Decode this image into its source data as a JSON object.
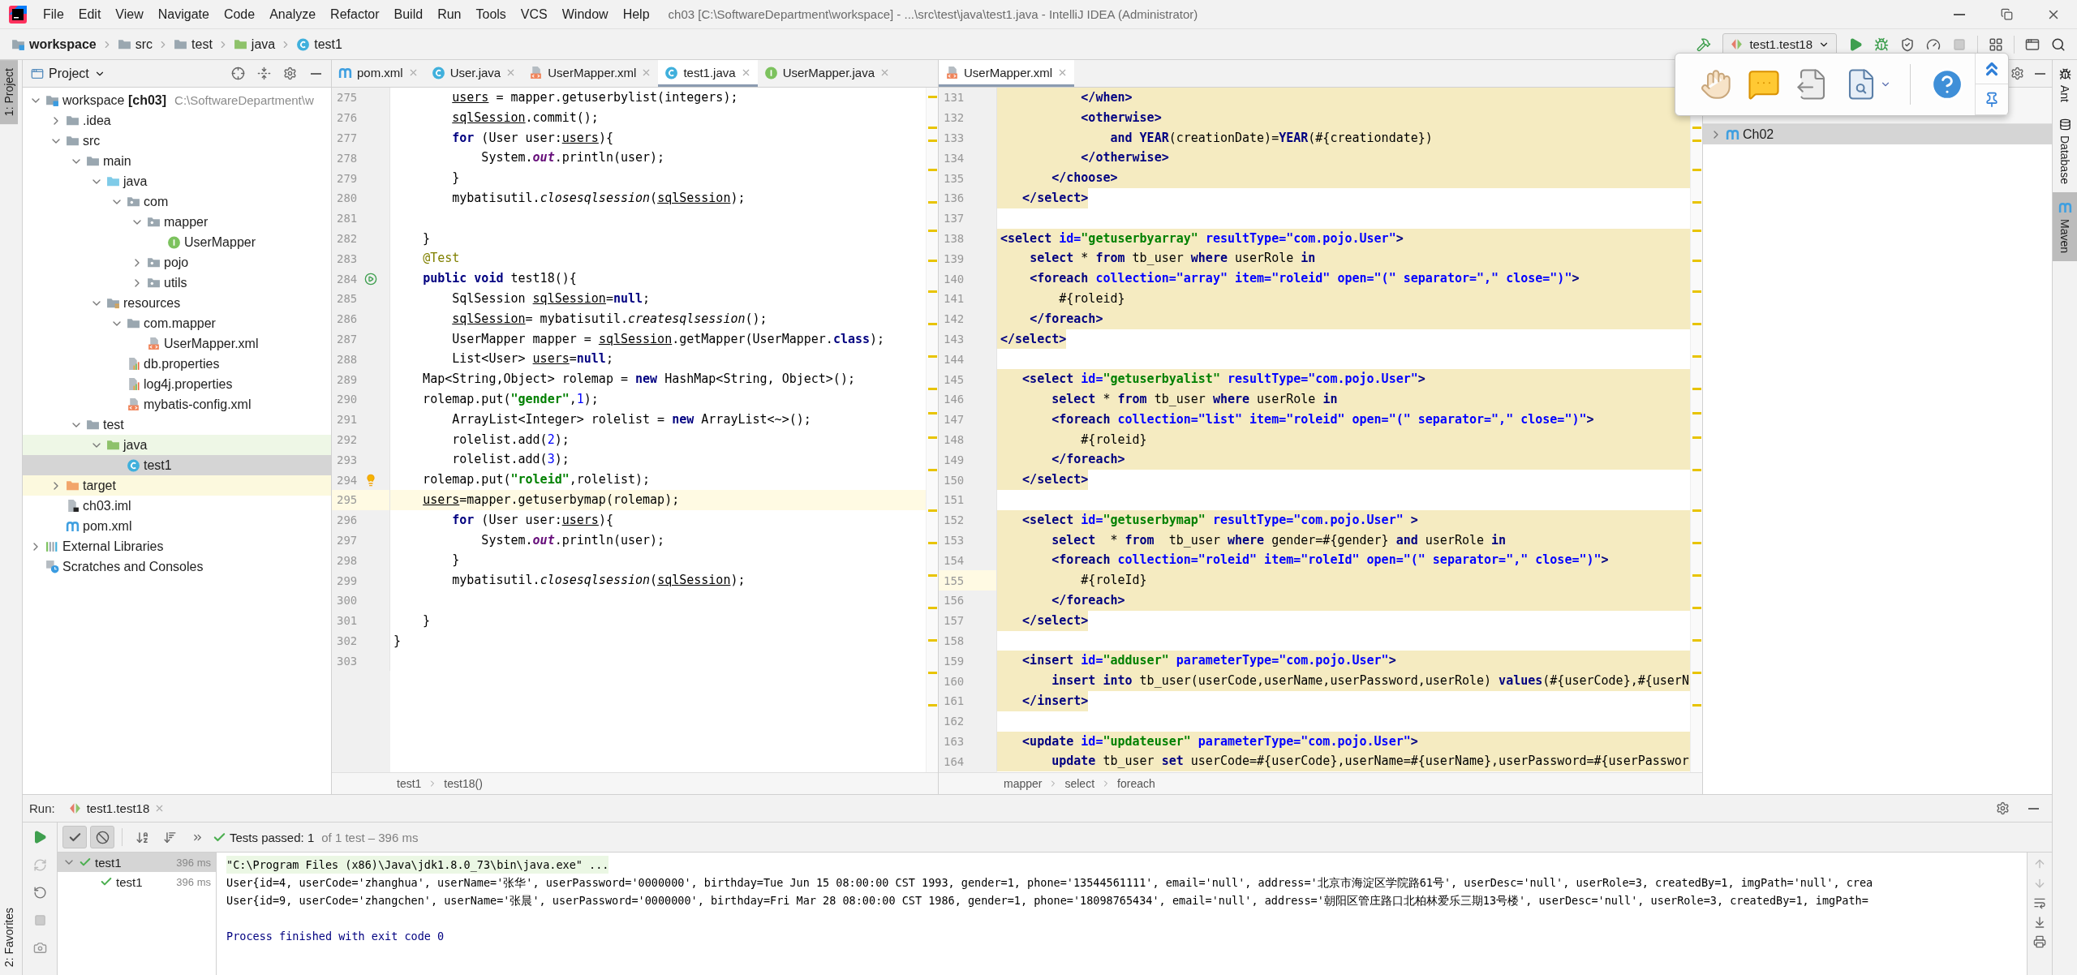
{
  "window": {
    "title": "ch03 [C:\\SoftwareDepartment\\workspace] - ...\\src\\test\\java\\test1.java - IntelliJ IDEA (Administrator)"
  },
  "menu": [
    "File",
    "Edit",
    "View",
    "Navigate",
    "Code",
    "Analyze",
    "Refactor",
    "Build",
    "Run",
    "Tools",
    "VCS",
    "Window",
    "Help"
  ],
  "breadcrumbs": [
    {
      "label": "workspace",
      "kind": "module"
    },
    {
      "label": "src",
      "kind": "folder"
    },
    {
      "label": "test",
      "kind": "folder"
    },
    {
      "label": "java",
      "kind": "test-folder"
    },
    {
      "label": "test1",
      "kind": "class"
    }
  ],
  "run_config": {
    "label": "test1.test18"
  },
  "left_strip": {
    "top": [
      {
        "label": "1: Project",
        "selected": true
      }
    ],
    "bottom": [
      {
        "label": "2: Favorites",
        "selected": false
      }
    ]
  },
  "right_strip": [
    {
      "label": "Ant",
      "kind": "ant",
      "selected": false
    },
    {
      "label": "Database",
      "kind": "database",
      "selected": false
    },
    {
      "label": "Maven",
      "kind": "maven",
      "selected": true
    }
  ],
  "project": {
    "title": "Project",
    "tree": [
      {
        "label": "workspace **[ch03]**",
        "path": "C:\\SoftwareDepartment\\w",
        "kind": "module",
        "expanded": true,
        "selected": false,
        "children": [
          {
            "label": ".idea",
            "kind": "folder",
            "expanded": false,
            "selected": false
          },
          {
            "label": "src",
            "kind": "folder",
            "expanded": true,
            "selected": false,
            "children": [
              {
                "label": "main",
                "kind": "folder",
                "expanded": true,
                "selected": false,
                "children": [
                  {
                    "label": "java",
                    "kind": "source-folder",
                    "expanded": true,
                    "selected": false,
                    "children": [
                      {
                        "label": "com",
                        "kind": "package",
                        "expanded": true,
                        "selected": false,
                        "children": [
                          {
                            "label": "mapper",
                            "kind": "package",
                            "expanded": true,
                            "selected": false,
                            "children": [
                              {
                                "label": "UserMapper",
                                "kind": "interface",
                                "selected": false
                              }
                            ]
                          },
                          {
                            "label": "pojo",
                            "kind": "package",
                            "expanded": false,
                            "selected": false
                          },
                          {
                            "label": "utils",
                            "kind": "package",
                            "expanded": false,
                            "selected": false
                          }
                        ]
                      }
                    ]
                  },
                  {
                    "label": "resources",
                    "kind": "resources-folder",
                    "expanded": true,
                    "selected": false,
                    "children": [
                      {
                        "label": "com.mapper",
                        "kind": "folder",
                        "expanded": true,
                        "selected": false,
                        "children": [
                          {
                            "label": "UserMapper.xml",
                            "kind": "xml",
                            "selected": false
                          }
                        ]
                      },
                      {
                        "label": "db.properties",
                        "kind": "properties",
                        "selected": false
                      },
                      {
                        "label": "log4j.properties",
                        "kind": "properties",
                        "selected": false
                      },
                      {
                        "label": "mybatis-config.xml",
                        "kind": "xml",
                        "selected": false
                      }
                    ]
                  }
                ]
              },
              {
                "label": "test",
                "kind": "folder",
                "expanded": true,
                "selected": false,
                "children": [
                  {
                    "label": "java",
                    "kind": "test-folder",
                    "expanded": true,
                    "selected": false,
                    "children": [
                      {
                        "label": "test1",
                        "kind": "class",
                        "selected": true
                      }
                    ]
                  }
                ]
              }
            ]
          },
          {
            "label": "target",
            "kind": "excluded-folder",
            "expanded": false,
            "selected": false
          },
          {
            "label": "ch03.iml",
            "kind": "iml",
            "selected": false
          },
          {
            "label": "pom.xml",
            "kind": "maven",
            "selected": false
          }
        ]
      },
      {
        "label": "External Libraries",
        "kind": "libraries",
        "expanded": false,
        "selected": false
      },
      {
        "label": "Scratches and Consoles",
        "kind": "scratches",
        "selected": false
      }
    ]
  },
  "editor_left": {
    "tabs": [
      {
        "label": "pom.xml",
        "kind": "maven",
        "selected": false
      },
      {
        "label": "User.java",
        "kind": "class",
        "selected": false
      },
      {
        "label": "UserMapper.xml",
        "kind": "xml",
        "selected": false
      },
      {
        "label": "test1.java",
        "kind": "class",
        "selected": true
      },
      {
        "label": "UserMapper.java",
        "kind": "interface",
        "selected": false
      }
    ],
    "lines": [
      {
        "number": "275",
        "segments": [
          {
            "text": "        users",
            "kind": "reassigned"
          },
          " = mapper.getuserbylist(integers);"
        ]
      },
      {
        "number": "276",
        "segments": [
          {
            "text": "        sqlSession",
            "kind": "reassigned"
          },
          ".commit();"
        ]
      },
      {
        "number": "277",
        "segments": [
          {
            "text": "        for",
            "kind": "keyword"
          },
          " (User user:",
          {
            "text": "users",
            "kind": "reassigned"
          },
          "){"
        ]
      },
      {
        "number": "278",
        "segments": [
          "            System.",
          {
            "text": "out",
            "kind": "static-field"
          },
          ".println(user);"
        ]
      },
      {
        "number": "279",
        "segments": [
          "        }"
        ]
      },
      {
        "number": "280",
        "segments": [
          "        mybatisutil.",
          {
            "text": "closesqlsession",
            "kind": "static-method"
          },
          "(",
          {
            "text": "sqlSession",
            "kind": "reassigned"
          },
          ");"
        ]
      },
      {
        "number": "281"
      },
      {
        "number": "282",
        "segments": [
          "    }"
        ]
      },
      {
        "number": "283",
        "segments": [
          {
            "text": "    @Test",
            "kind": "annotation"
          }
        ]
      },
      {
        "number": "284",
        "run_marker": true,
        "segments": [
          {
            "text": "    public void",
            "kind": "keyword"
          },
          " test18(){"
        ]
      },
      {
        "number": "285",
        "segments": [
          "        SqlSession ",
          {
            "text": "sqlSession",
            "kind": "reassigned"
          },
          "=",
          {
            "text": "null",
            "kind": "keyword"
          },
          ";"
        ]
      },
      {
        "number": "286",
        "segments": [
          {
            "text": "        sqlSession",
            "kind": "reassigned"
          },
          "= mybatisutil.",
          {
            "text": "createsqlsession",
            "kind": "static-method"
          },
          "();"
        ]
      },
      {
        "number": "287",
        "segments": [
          "        UserMapper mapper = ",
          {
            "text": "sqlSession",
            "kind": "reassigned"
          },
          ".getMapper(UserMapper.",
          {
            "text": "class",
            "kind": "keyword"
          },
          ");"
        ]
      },
      {
        "number": "288",
        "segments": [
          "        List<User> ",
          {
            "text": "users",
            "kind": "reassigned"
          },
          "=",
          {
            "text": "null",
            "kind": "keyword"
          },
          ";"
        ]
      },
      {
        "number": "289",
        "segments": [
          "    Map<String,Object> rolemap = ",
          {
            "text": "new",
            "kind": "keyword"
          },
          " HashMap<String, Object>();"
        ]
      },
      {
        "number": "290",
        "segments": [
          "    rolemap.put(",
          {
            "text": "\"gender\"",
            "kind": "string"
          },
          ",",
          {
            "text": "1",
            "kind": "number"
          },
          ");"
        ]
      },
      {
        "number": "291",
        "segments": [
          "        ArrayList<Integer> rolelist = ",
          {
            "text": "new",
            "kind": "keyword"
          },
          " ArrayList<~>();"
        ]
      },
      {
        "number": "292",
        "segments": [
          "        rolelist.add(",
          {
            "text": "2",
            "kind": "number"
          },
          ");"
        ]
      },
      {
        "number": "293",
        "segments": [
          "        rolelist.add(",
          {
            "text": "3",
            "kind": "number"
          },
          ");"
        ]
      },
      {
        "number": "294",
        "bulb": true,
        "segments": [
          "    rolemap.put(",
          {
            "text": "\"roleid\"",
            "kind": "string"
          },
          ",rolelist);"
        ]
      },
      {
        "number": "295",
        "current": true,
        "segments": [
          {
            "text": "    users",
            "kind": "reassigned"
          },
          "=mapper.getuserbymap(rolemap);"
        ]
      },
      {
        "number": "296",
        "segments": [
          {
            "text": "        for",
            "kind": "keyword"
          },
          " (User user:",
          {
            "text": "users",
            "kind": "reassigned"
          },
          "){"
        ]
      },
      {
        "number": "297",
        "segments": [
          "            System.",
          {
            "text": "out",
            "kind": "static-field"
          },
          ".println(user);"
        ]
      },
      {
        "number": "298",
        "segments": [
          "        }"
        ]
      },
      {
        "number": "299",
        "segments": [
          "        mybatisutil.",
          {
            "text": "closesqlsession",
            "kind": "static-method"
          },
          "(",
          {
            "text": "sqlSession",
            "kind": "reassigned"
          },
          ");"
        ]
      },
      {
        "number": "300"
      },
      {
        "number": "301",
        "segments": [
          "    }"
        ]
      },
      {
        "number": "302",
        "segments": [
          "}"
        ]
      },
      {
        "number": "303"
      }
    ],
    "breadcrumbs": [
      "test1",
      "test18()"
    ]
  },
  "editor_right": {
    "tabs": [
      {
        "label": "UserMapper.xml",
        "kind": "xml",
        "selected": true
      }
    ],
    "lines": [
      {
        "number": "131",
        "band": true,
        "segments": [
          {
            "text": "           </when>",
            "kind": "tag"
          }
        ]
      },
      {
        "number": "132",
        "band": true,
        "segments": [
          {
            "text": "           <otherwise>",
            "kind": "tag"
          }
        ]
      },
      {
        "number": "133",
        "band": true,
        "segments": [
          {
            "text": "               and",
            "kind": "sql-keyword"
          },
          {
            "text": " YEAR",
            "kind": "sql-keyword"
          },
          "(creationDate)=",
          {
            "text": "YEAR",
            "kind": "sql-keyword"
          },
          "(#{creationdate})"
        ]
      },
      {
        "number": "134",
        "band": true,
        "segments": [
          {
            "text": "           </otherwise>",
            "kind": "tag"
          }
        ]
      },
      {
        "number": "135",
        "band": true,
        "segments": [
          {
            "text": "       </choose>",
            "kind": "tag"
          }
        ]
      },
      {
        "number": "136",
        "shaded": true,
        "segments": [
          {
            "text": "   </select>",
            "kind": "tag"
          }
        ]
      },
      {
        "number": "137"
      },
      {
        "number": "138",
        "band": true,
        "segments": [
          {
            "text": "<select",
            "kind": "tag"
          },
          {
            "text": " id=",
            "kind": "attribute"
          },
          {
            "text": "\"getuserbyarray\"",
            "kind": "value"
          },
          {
            "text": " resultType=\"com.pojo.User\"",
            "kind": "attribute"
          },
          {
            "text": ">",
            "kind": "tag"
          }
        ]
      },
      {
        "number": "139",
        "band": true,
        "segments": [
          {
            "text": "    select",
            "kind": "sql-keyword"
          },
          " * ",
          {
            "text": "from",
            "kind": "sql-keyword"
          },
          " tb_user ",
          {
            "text": "where",
            "kind": "sql-keyword"
          },
          " userRole ",
          {
            "text": "in",
            "kind": "sql-keyword"
          }
        ]
      },
      {
        "number": "140",
        "band": true,
        "segments": [
          {
            "text": "    <foreach",
            "kind": "tag"
          },
          {
            "text": " collection=\"array\" item=\"roleid\" open=\"(\" separator=\",\" close=\")\"",
            "kind": "attribute"
          },
          {
            "text": ">",
            "kind": "tag"
          }
        ]
      },
      {
        "number": "141",
        "band": true,
        "segments": [
          "        #{roleid}"
        ]
      },
      {
        "number": "142",
        "band": true,
        "segments": [
          {
            "text": "    </foreach>",
            "kind": "tag"
          }
        ]
      },
      {
        "number": "143",
        "shaded": true,
        "segments": [
          {
            "text": "</select>",
            "kind": "tag"
          }
        ]
      },
      {
        "number": "144"
      },
      {
        "number": "145",
        "band": true,
        "segments": [
          {
            "text": "   <select",
            "kind": "tag"
          },
          {
            "text": " id=",
            "kind": "attribute"
          },
          {
            "text": "\"getuserbyalist\"",
            "kind": "value"
          },
          {
            "text": " resultType=\"com.pojo.User\"",
            "kind": "attribute"
          },
          {
            "text": ">",
            "kind": "tag"
          }
        ]
      },
      {
        "number": "146",
        "band": true,
        "segments": [
          {
            "text": "       select",
            "kind": "sql-keyword"
          },
          " * ",
          {
            "text": "from",
            "kind": "sql-keyword"
          },
          " tb_user ",
          {
            "text": "where",
            "kind": "sql-keyword"
          },
          " userRole ",
          {
            "text": "in",
            "kind": "sql-keyword"
          }
        ]
      },
      {
        "number": "147",
        "band": true,
        "segments": [
          {
            "text": "       <foreach",
            "kind": "tag"
          },
          {
            "text": " collection=\"list\" item=\"roleid\" open=\"(\" separator=\",\" close=\")\"",
            "kind": "attribute"
          },
          {
            "text": ">",
            "kind": "tag"
          }
        ]
      },
      {
        "number": "148",
        "band": true,
        "segments": [
          "           #{roleid}"
        ]
      },
      {
        "number": "149",
        "band": true,
        "segments": [
          {
            "text": "       </foreach>",
            "kind": "tag"
          }
        ]
      },
      {
        "number": "150",
        "shaded": true,
        "segments": [
          {
            "text": "   </select>",
            "kind": "tag"
          }
        ]
      },
      {
        "number": "151"
      },
      {
        "number": "152",
        "band": true,
        "segments": [
          {
            "text": "   <select",
            "kind": "tag"
          },
          {
            "text": " id=",
            "kind": "attribute"
          },
          {
            "text": "\"getuserbymap\"",
            "kind": "value"
          },
          {
            "text": " resultType=\"com.pojo.User\"",
            "kind": "attribute"
          },
          {
            "text": " >",
            "kind": "tag"
          }
        ]
      },
      {
        "number": "153",
        "band": true,
        "segments": [
          {
            "text": "       select",
            "kind": "sql-keyword"
          },
          "  * ",
          {
            "text": "from",
            "kind": "sql-keyword"
          },
          "  tb_user ",
          {
            "text": "where",
            "kind": "sql-keyword"
          },
          " gender=#{gender} ",
          {
            "text": "and",
            "kind": "sql-keyword"
          },
          " userRole ",
          {
            "text": "in",
            "kind": "sql-keyword"
          }
        ]
      },
      {
        "number": "154",
        "band": true,
        "segments": [
          {
            "text": "       <foreach",
            "kind": "tag"
          },
          {
            "text": " collection=\"roleid\" item=\"roleId\" open=\"(\" separator=\",\" close=\")\"",
            "kind": "attribute"
          },
          {
            "text": ">",
            "kind": "tag"
          }
        ]
      },
      {
        "number": "155",
        "band": true,
        "current": true,
        "segments": [
          "           #{roleId}"
        ]
      },
      {
        "number": "156",
        "band": true,
        "segments": [
          {
            "text": "       </foreach>",
            "kind": "tag"
          }
        ]
      },
      {
        "number": "157",
        "shaded": true,
        "segments": [
          {
            "text": "   </select>",
            "kind": "tag"
          }
        ]
      },
      {
        "number": "158"
      },
      {
        "number": "159",
        "band": true,
        "segments": [
          {
            "text": "   <insert",
            "kind": "tag"
          },
          {
            "text": " id=",
            "kind": "attribute"
          },
          {
            "text": "\"adduser\"",
            "kind": "value"
          },
          {
            "text": " parameterType=\"com.pojo.User\"",
            "kind": "attribute"
          },
          {
            "text": ">",
            "kind": "tag"
          }
        ]
      },
      {
        "number": "160",
        "band": true,
        "segments": [
          {
            "text": "       insert into",
            "kind": "sql-keyword"
          },
          " tb_user(userCode,userName,userPassword,userRole) ",
          {
            "text": "values",
            "kind": "sql-keyword"
          },
          "(#{userCode},#{userN"
        ]
      },
      {
        "number": "161",
        "shaded": true,
        "segments": [
          {
            "text": "   </insert>",
            "kind": "tag"
          }
        ]
      },
      {
        "number": "162"
      },
      {
        "number": "163",
        "band": true,
        "segments": [
          {
            "text": "   <update",
            "kind": "tag"
          },
          {
            "text": " id=",
            "kind": "attribute"
          },
          {
            "text": "\"updateuser\"",
            "kind": "value"
          },
          {
            "text": " parameterType=\"com.pojo.User\"",
            "kind": "attribute"
          },
          {
            "text": ">",
            "kind": "tag"
          }
        ]
      },
      {
        "number": "164",
        "band": true,
        "segments": [
          {
            "text": "       update",
            "kind": "sql-keyword"
          },
          " tb_user ",
          {
            "text": "set",
            "kind": "sql-keyword"
          },
          " userCode=#{userCode},userName=#{userName},userPassword=#{userPasswor"
        ]
      }
    ],
    "breadcrumbs": [
      "mapper",
      "select",
      "foreach"
    ]
  },
  "maven": {
    "items": [
      {
        "label": "Ch02",
        "kind": "maven",
        "expanded": false,
        "selected": true
      }
    ]
  },
  "run": {
    "title": "Run:",
    "tab": "test1.test18",
    "status": {
      "main": "Tests passed: 1",
      "detail": "of 1 test – 396 ms"
    },
    "tests": [
      {
        "label": "test1",
        "time": "396 ms",
        "passed": true,
        "selected": true,
        "expanded": true,
        "children": [
          {
            "label": "test1",
            "time": "396 ms",
            "passed": true,
            "selected": false
          }
        ]
      }
    ],
    "console": [
      {
        "kind": "command",
        "text": "\"C:\\Program Files (x86)\\Java\\jdk1.8.0_73\\bin\\java.exe\" ..."
      },
      {
        "kind": "output",
        "text": "User{id=4, userCode='zhanghua', userName='张华', userPassword='0000000', birthday=Tue Jun 15 08:00:00 CST 1993, gender=1, phone='13544561111', email='null', address='北京市海淀区学院路61号', userDesc='null', userRole=3, createdBy=1, imgPath='null', crea"
      },
      {
        "kind": "output",
        "text": "User{id=9, userCode='zhangchen', userName='张晨', userPassword='0000000', birthday=Fri Mar 28 08:00:00 CST 1986, gender=1, phone='18098765434', email='null', address='朝阳区管庄路口北柏林爱乐三期13号楼', userDesc='null', userRole=3, createdBy=1, imgPath="
      },
      {
        "kind": "blank"
      },
      {
        "kind": "exit",
        "text": "Process finished with exit code 0"
      }
    ]
  }
}
